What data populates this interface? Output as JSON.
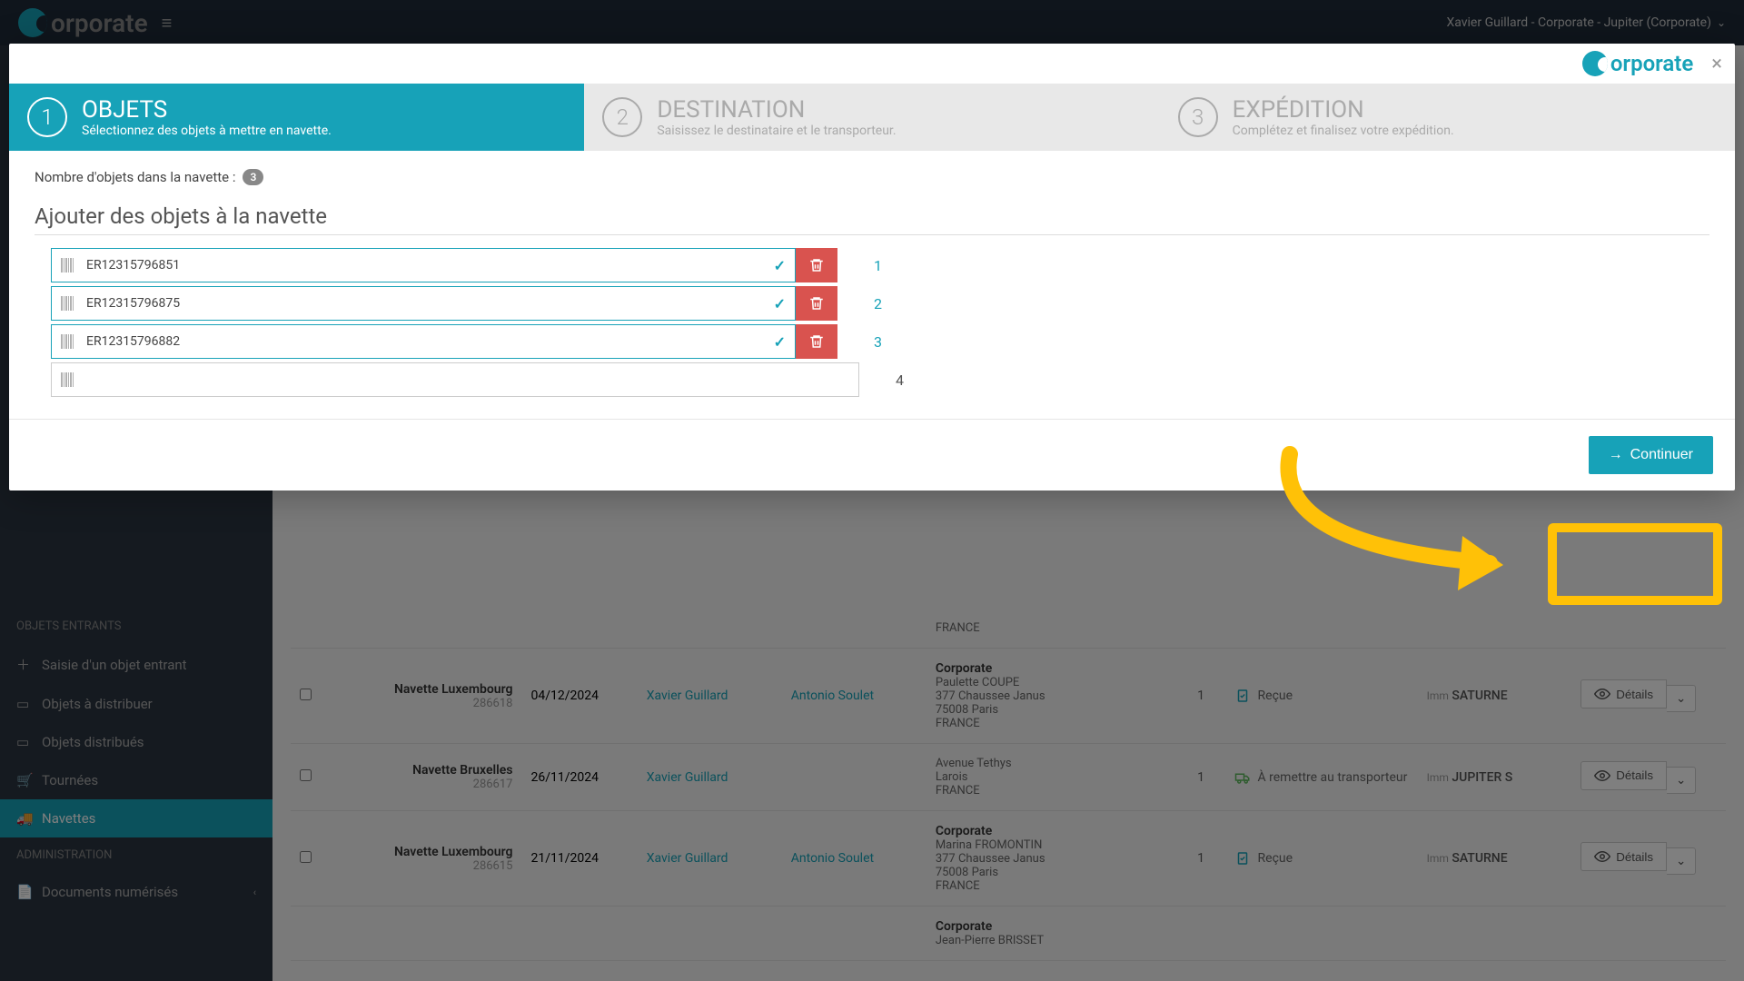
{
  "topbar": {
    "brand": "orporate",
    "user": "Xavier Guillard - Corporate - Jupiter (Corporate)"
  },
  "sidebar": {
    "section_entrants": "OBJETS ENTRANTS",
    "items_entrants": [
      {
        "label": "Saisie d'un objet entrant"
      },
      {
        "label": "Objets à distribuer"
      },
      {
        "label": "Objets distribués"
      },
      {
        "label": "Tournées"
      },
      {
        "label": "Navettes",
        "active": true
      }
    ],
    "section_admin": "ADMINISTRATION",
    "items_admin": [
      {
        "label": "Documents numérisés"
      }
    ]
  },
  "modal": {
    "brand": "orporate",
    "close": "×",
    "steps": [
      {
        "num": "1",
        "title": "OBJETS",
        "sub": "Sélectionnez des objets à mettre en navette."
      },
      {
        "num": "2",
        "title": "DESTINATION",
        "sub": "Saisissez le destinataire et le transporteur."
      },
      {
        "num": "3",
        "title": "EXPÉDITION",
        "sub": "Complétez et finalisez votre expédition."
      }
    ],
    "count_label": "Nombre d'objets dans la navette :",
    "count_value": "3",
    "section_title": "Ajouter des objets à la navette",
    "objects": [
      {
        "code": "ER12315796851",
        "num": "1"
      },
      {
        "code": "ER12315796875",
        "num": "2"
      },
      {
        "code": "ER12315796882",
        "num": "3"
      }
    ],
    "empty_num": "4",
    "continue": "Continuer"
  },
  "table": {
    "rows": [
      {
        "route": "Navette Luxembourg",
        "route_id": "286618",
        "date": "04/12/2024",
        "user1": "Xavier Guillard",
        "user2": "Antonio Soulet",
        "company": "Corporate",
        "name": "Paulette COUPE",
        "addr1": "377 Chaussee Janus",
        "addr2": "75008 Paris",
        "country": "FRANCE",
        "qty": "1",
        "status": "Reçue",
        "status_type": "received",
        "loc_prefix": "Imm",
        "loc": "SATURNE",
        "details": "Détails"
      },
      {
        "route": "Navette Bruxelles",
        "route_id": "286617",
        "date": "26/11/2024",
        "user1": "Xavier Guillard",
        "user2": "",
        "company": "",
        "name": "Avenue Tethys",
        "addr1": "Larois",
        "addr2": "",
        "country": "FRANCE",
        "qty": "1",
        "status": "À remettre au transporteur",
        "status_type": "transit",
        "loc_prefix": "Imm",
        "loc": "JUPITER S",
        "details": "Détails"
      },
      {
        "route": "Navette Luxembourg",
        "route_id": "286615",
        "date": "21/11/2024",
        "user1": "Xavier Guillard",
        "user2": "Antonio Soulet",
        "company": "Corporate",
        "name": "Marina FROMONTIN",
        "addr1": "377 Chaussee Janus",
        "addr2": "75008 Paris",
        "country": "FRANCE",
        "qty": "1",
        "status": "Reçue",
        "status_type": "received",
        "loc_prefix": "Imm",
        "loc": "SATURNE",
        "details": "Détails"
      }
    ],
    "partial_company": "Corporate",
    "partial_name": "Jean-Pierre BRISSET"
  }
}
